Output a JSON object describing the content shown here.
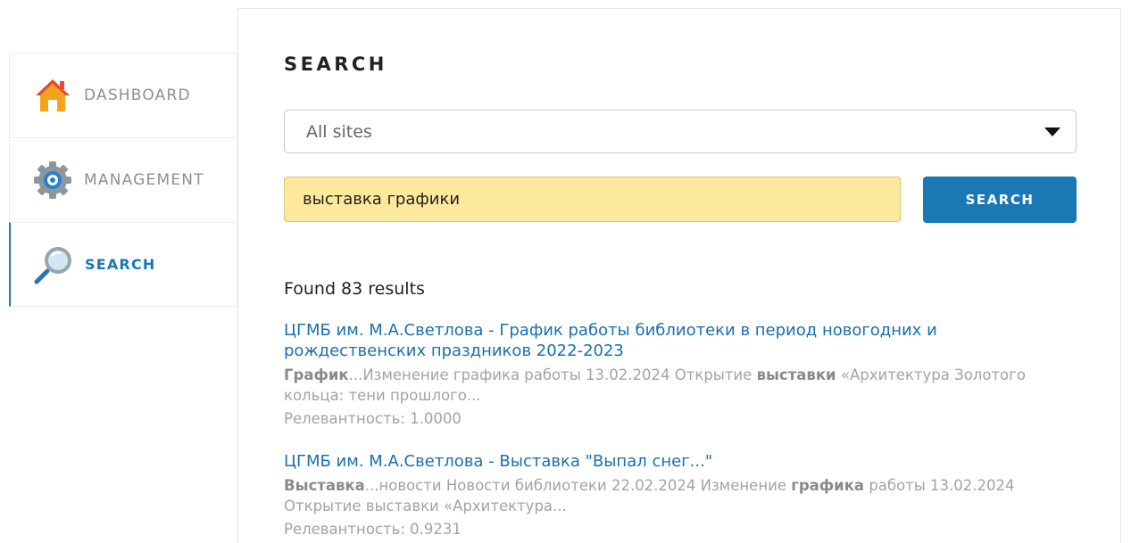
{
  "sidebar": {
    "items": [
      {
        "label": "DASHBOARD",
        "icon": "home-icon",
        "active": false
      },
      {
        "label": "MANAGEMENT",
        "icon": "gear-icon",
        "active": false
      },
      {
        "label": "SEARCH",
        "icon": "magnifier-icon",
        "active": true
      }
    ]
  },
  "main": {
    "title": "SEARCH",
    "site_select": {
      "value": "All sites"
    },
    "query": {
      "value": "выставка графики"
    },
    "search_button": "SEARCH",
    "found_text": "Found 83 results",
    "results": [
      {
        "title": "ЦГМБ им. М.А.Светлова - График работы библиотеки в период новогодних и рождественских праздников 2022-2023",
        "snippet": [
          {
            "t": "График",
            "b": true
          },
          {
            "t": "...Изменение графика работы 13.02.2024 Открытие ",
            "b": false
          },
          {
            "t": "выставки",
            "b": true
          },
          {
            "t": " «Архитектура Золотого кольца: тени прошлого...",
            "b": false
          }
        ],
        "relevance": "Релевантность: 1.0000"
      },
      {
        "title": "ЦГМБ им. М.А.Светлова - Выставка \"Выпал снег...\"",
        "snippet": [
          {
            "t": "Выставка",
            "b": true
          },
          {
            "t": "...новости Новости библиотеки 22.02.2024 Изменение ",
            "b": false
          },
          {
            "t": "графика",
            "b": true
          },
          {
            "t": " работы 13.02.2024 Открытие выставки «Архитектура...",
            "b": false
          }
        ],
        "relevance": "Релевантность: 0.9231"
      }
    ]
  },
  "colors": {
    "accent": "#1a78b5",
    "query_bg": "#fde99c",
    "muted_text": "#a3a3a3"
  }
}
